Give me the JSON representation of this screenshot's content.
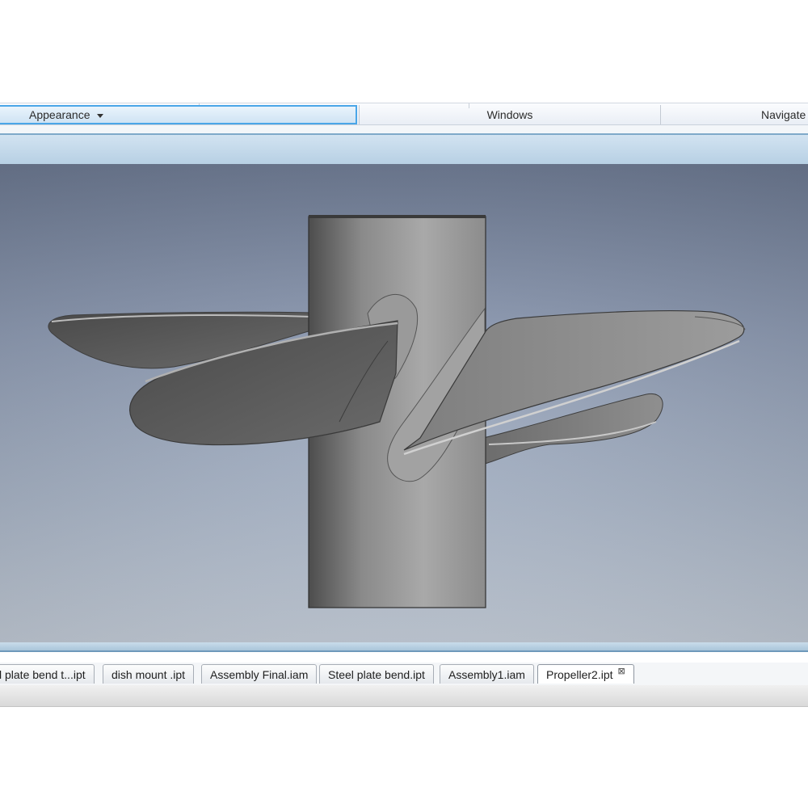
{
  "ribbon": {
    "panels": [
      {
        "label": "Appearance",
        "has_dropdown": true,
        "selected": true
      },
      {
        "label": "Windows"
      },
      {
        "label": "Navigate"
      }
    ]
  },
  "document_tabs": [
    {
      "label": "l plate bend t...ipt"
    },
    {
      "label": "dish mount .ipt"
    },
    {
      "label": "Assembly Final.iam"
    },
    {
      "label": "Steel plate bend.ipt"
    },
    {
      "label": "Assembly1.iam"
    },
    {
      "label": "Propeller2.ipt",
      "active": true,
      "close_glyph": "⊠"
    }
  ],
  "colors": {
    "accent": "#4aa6e8",
    "viewport_top": "#6f7c95",
    "viewport_bottom": "#c7d0dc",
    "model_gray": "#8a8a8a"
  }
}
